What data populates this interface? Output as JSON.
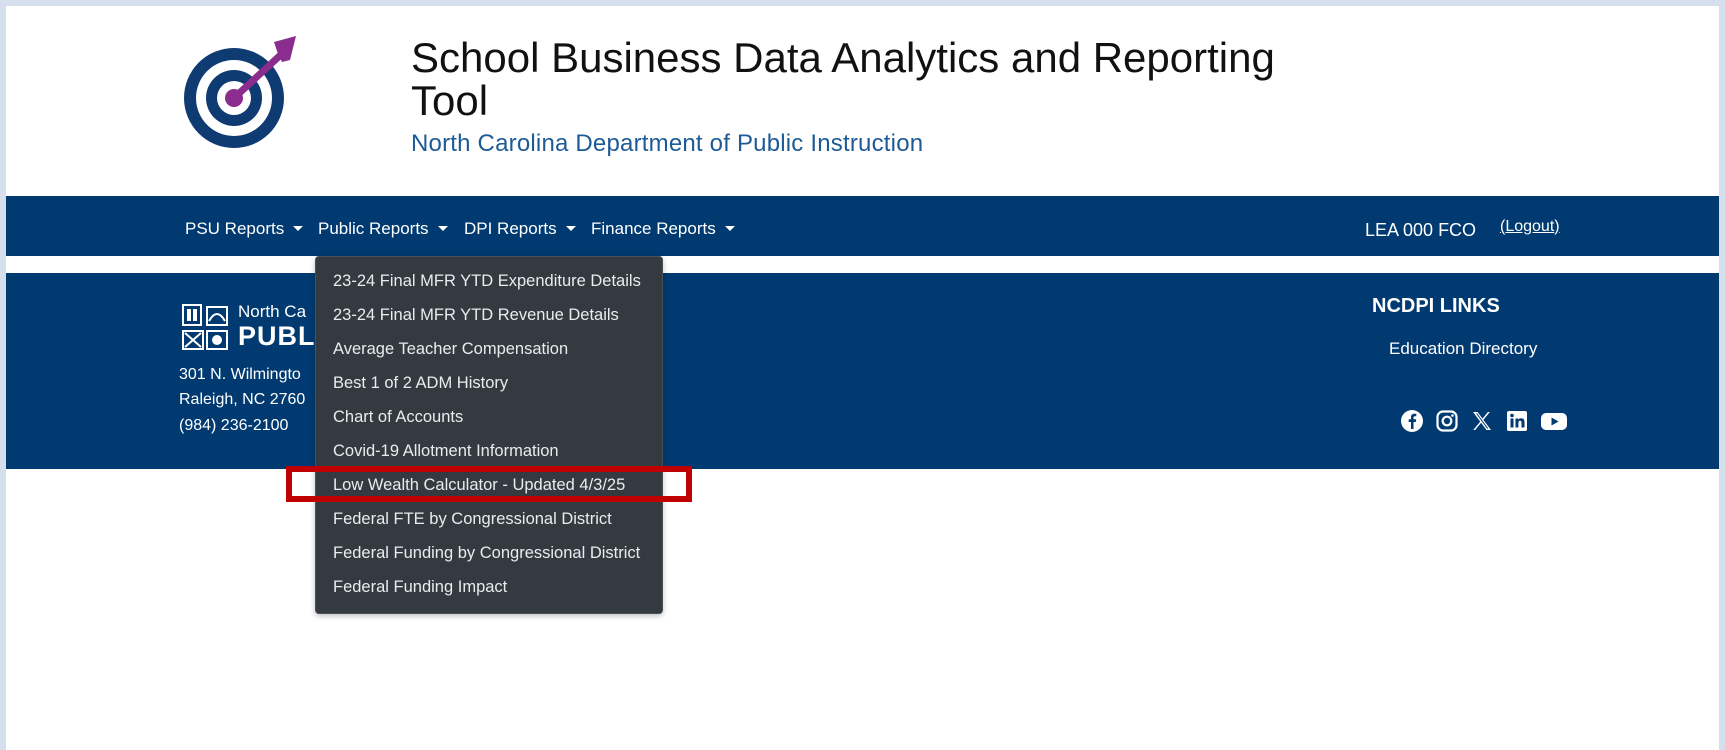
{
  "header": {
    "title": "School Business Data Analytics and Reporting Tool",
    "subtitle": "North Carolina Department of Public Instruction",
    "logo_icon": "target-dart-icon",
    "brand_colors": {
      "navy": "#003a70",
      "purple": "#8b2c8f",
      "blue": "#1d5a96"
    }
  },
  "nav": {
    "items": [
      {
        "label": "PSU Reports"
      },
      {
        "label": "Public Reports"
      },
      {
        "label": "DPI Reports"
      },
      {
        "label": "Finance Reports"
      }
    ],
    "user": "LEA 000 FCO",
    "logout": "Logout"
  },
  "dropdown": {
    "items": [
      "23-24 Final MFR YTD Expenditure Details",
      "23-24 Final MFR YTD Revenue Details",
      "Average Teacher Compensation",
      "Best 1 of 2 ADM History",
      "Chart of Accounts",
      "Covid-19 Allotment Information",
      "Low Wealth Calculator - Updated 4/3/25",
      "Federal FTE by Congressional District",
      "Federal Funding by Congressional District",
      "Federal Funding Impact"
    ],
    "highlighted": "Low Wealth Calculator - Updated 4/3/25",
    "highlight_color": "#c00000"
  },
  "footer": {
    "org_small": "North Ca",
    "org_big": "PUBLI",
    "address1": "301 N. Wilmingto",
    "address2": "Raleigh, NC 2760",
    "phone": "(984) 236-2100",
    "links_title": "NCDPI LINKS",
    "links": [
      "Education Directory"
    ],
    "social_icons": [
      "facebook-icon",
      "instagram-icon",
      "x-icon",
      "linkedin-icon",
      "youtube-icon"
    ]
  }
}
